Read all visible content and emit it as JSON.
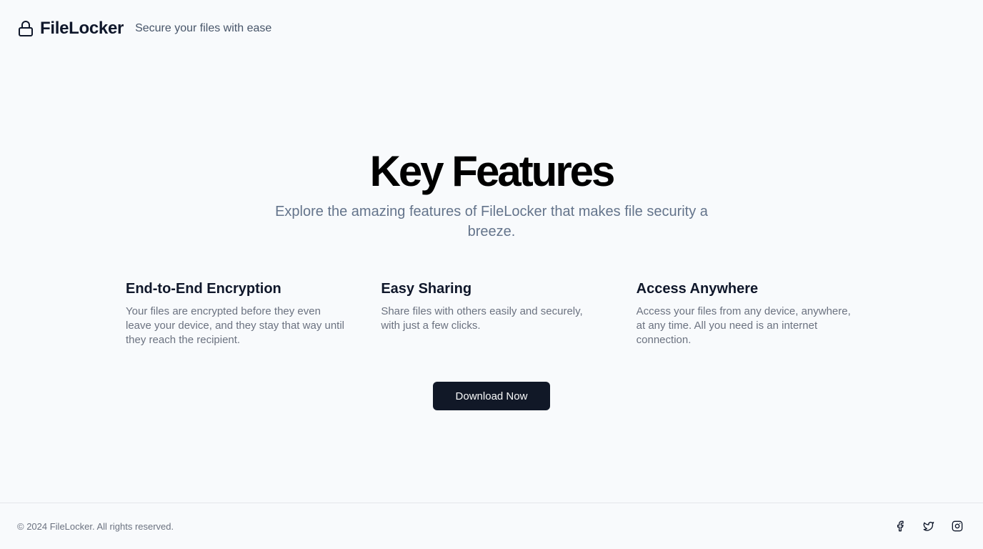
{
  "header": {
    "brand_name": "FileLocker",
    "tagline": "Secure your files with ease",
    "brand_icon": "lock-icon"
  },
  "main": {
    "title": "Key Features",
    "subtitle": "Explore the amazing features of FileLocker that makes file security a breeze.",
    "features": [
      {
        "title": "End-to-End Encryption",
        "description": "Your files are encrypted before they even leave your device, and they stay that way until they reach the recipient."
      },
      {
        "title": "Easy Sharing",
        "description": "Share files with others easily and securely, with just a few clicks."
      },
      {
        "title": "Access Anywhere",
        "description": "Access your files from any device, anywhere, at any time. All you need is an internet connection."
      }
    ],
    "cta_label": "Download Now"
  },
  "footer": {
    "copyright": "© 2024 FileLocker. All rights reserved.",
    "social_icons": [
      "facebook-icon",
      "twitter-icon",
      "instagram-icon"
    ]
  },
  "colors": {
    "background": "#f8fafc",
    "primary_button": "#111827",
    "text_muted": "#6b7280"
  }
}
